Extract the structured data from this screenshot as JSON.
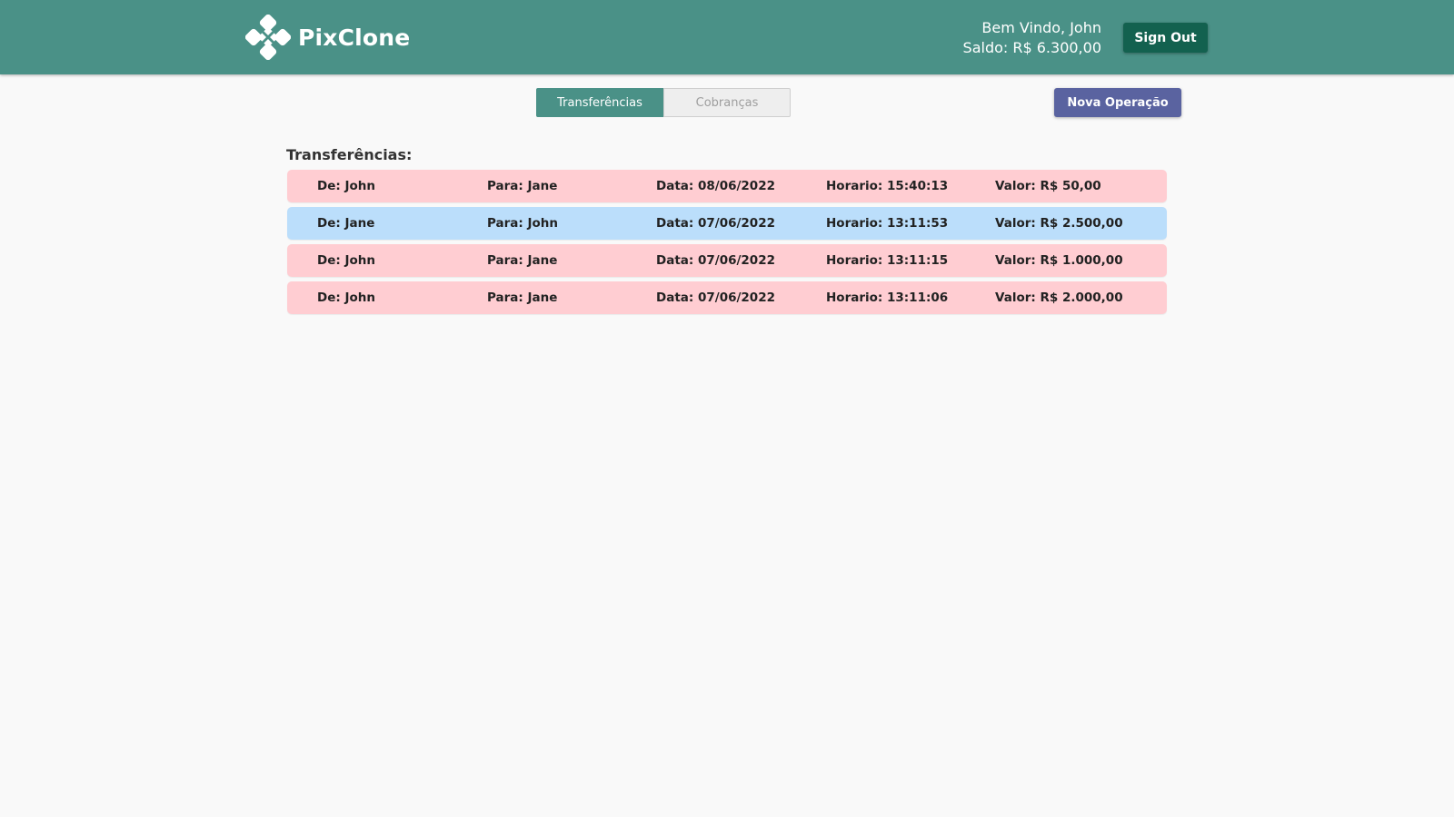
{
  "app": {
    "name": "PixClone",
    "logo_icon": "diamond-petals-logo-icon"
  },
  "header": {
    "welcome": "Bem Vindo, John",
    "balance": "Saldo: R$ 6.300,00",
    "signout_label": "Sign Out"
  },
  "tabs": [
    {
      "label": "Transferências",
      "active": true
    },
    {
      "label": "Cobranças",
      "active": false
    }
  ],
  "new_operation_label": "Nova Operação",
  "section_title": "Transferências:",
  "transfers": [
    {
      "direction": "sent",
      "from": "De: John",
      "to": "Para: Jane",
      "date": "Data: 08/06/2022",
      "time": "Horario: 15:40:13",
      "value": "Valor: R$ 50,00"
    },
    {
      "direction": "received",
      "from": "De: Jane",
      "to": "Para: John",
      "date": "Data: 07/06/2022",
      "time": "Horario: 13:11:53",
      "value": "Valor: R$ 2.500,00"
    },
    {
      "direction": "sent",
      "from": "De: John",
      "to": "Para: Jane",
      "date": "Data: 07/06/2022",
      "time": "Horario: 13:11:15",
      "value": "Valor: R$ 1.000,00"
    },
    {
      "direction": "sent",
      "from": "De: John",
      "to": "Para: Jane",
      "date": "Data: 07/06/2022",
      "time": "Horario: 13:11:06",
      "value": "Valor: R$ 2.000,00"
    }
  ],
  "colors": {
    "header": "#4a9187",
    "signout": "#13614f",
    "new_operation": "#5a63a0",
    "sent_row": "#ffcdd2",
    "received_row": "#bbdefb",
    "background": "#f9f9f9"
  }
}
